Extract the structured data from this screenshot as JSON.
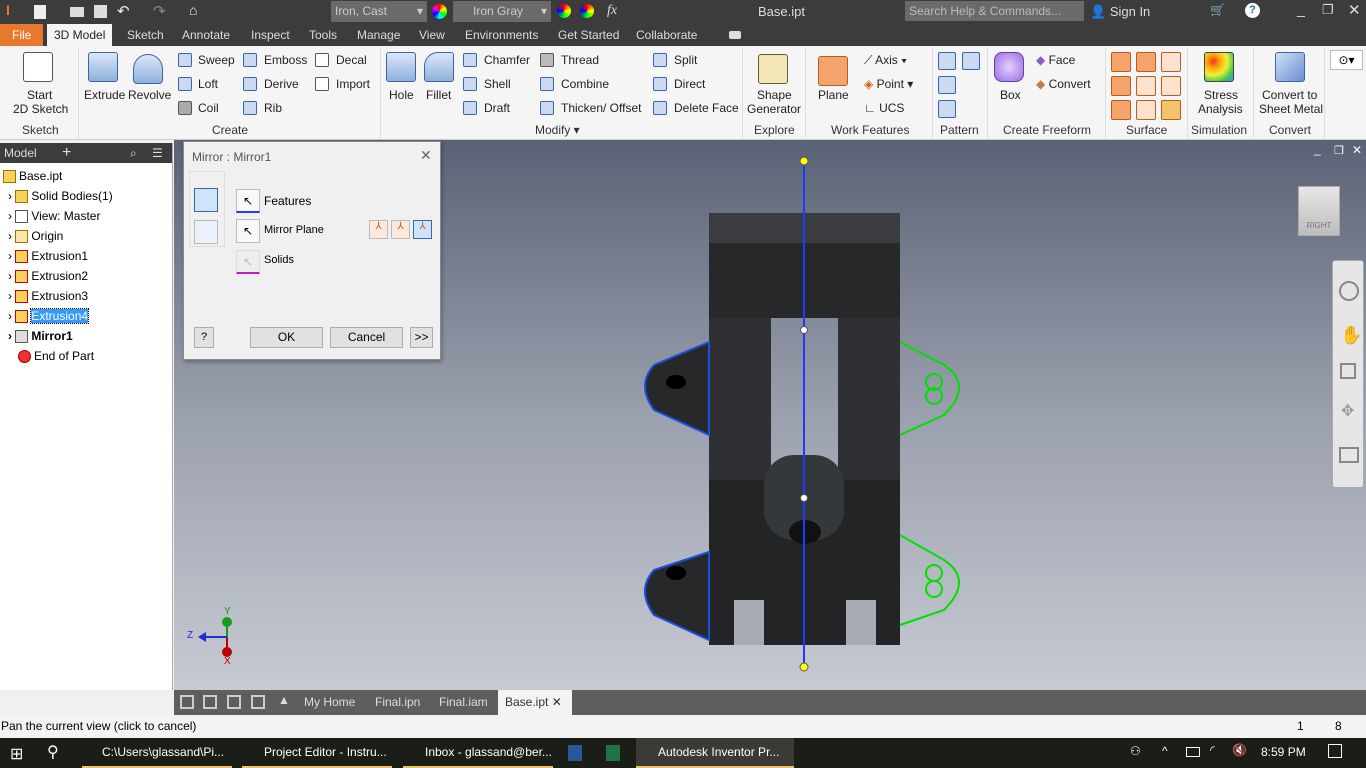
{
  "window": {
    "title": "Base.ipt",
    "search_placeholder": "Search Help & Commands...",
    "sign_in": "Sign In"
  },
  "qat": {
    "material": "Iron, Cast",
    "appearance": "Iron Gray",
    "fx": "fx"
  },
  "tabs": [
    "File",
    "3D Model",
    "Sketch",
    "Annotate",
    "Inspect",
    "Tools",
    "Manage",
    "View",
    "Environments",
    "Get Started",
    "Collaborate"
  ],
  "ribbon": {
    "sketch": {
      "start": "Start",
      "start2": "2D Sketch",
      "group": "Sketch"
    },
    "create": {
      "extrude": "Extrude",
      "revolve": "Revolve",
      "sweep": "Sweep",
      "loft": "Loft",
      "coil": "Coil",
      "emboss": "Emboss",
      "derive": "Derive",
      "rib": "Rib",
      "decal": "Decal",
      "import": "Import",
      "group": "Create"
    },
    "modify": {
      "hole": "Hole",
      "fillet": "Fillet",
      "chamfer": "Chamfer",
      "shell": "Shell",
      "draft": "Draft",
      "thread": "Thread",
      "combine": "Combine",
      "thicken": "Thicken/ Offset",
      "split": "Split",
      "direct": "Direct",
      "delete_face": "Delete Face",
      "group": "Modify"
    },
    "explore": {
      "shape1": "Shape",
      "shape2": "Generator",
      "group": "Explore"
    },
    "work": {
      "plane": "Plane",
      "axis": "Axis",
      "point": "Point",
      "ucs": "UCS",
      "group": "Work Features"
    },
    "pattern": {
      "group": "Pattern"
    },
    "freeform": {
      "box": "Box",
      "face": "Face",
      "convert": "Convert",
      "group": "Create Freeform"
    },
    "surface": {
      "group": "Surface"
    },
    "simulation": {
      "s1": "Stress",
      "s2": "Analysis",
      "group": "Simulation"
    },
    "convert": {
      "c1": "Convert to",
      "c2": "Sheet Metal",
      "group": "Convert"
    }
  },
  "browser": {
    "tab": "Model",
    "items": [
      {
        "label": "Base.ipt"
      },
      {
        "label": "Solid Bodies(1)"
      },
      {
        "label": "View: Master"
      },
      {
        "label": "Origin"
      },
      {
        "label": "Extrusion1"
      },
      {
        "label": "Extrusion2"
      },
      {
        "label": "Extrusion3"
      },
      {
        "label": "Extrusion4"
      },
      {
        "label": "Mirror1"
      },
      {
        "label": "End of Part"
      }
    ]
  },
  "dialog": {
    "title": "Mirror : Mirror1",
    "features": "Features",
    "mirror_plane": "Mirror Plane",
    "solids": "Solids",
    "ok": "OK",
    "cancel": "Cancel",
    "more": ">>",
    "help": "?"
  },
  "viewcube": {
    "face": "RIGHT"
  },
  "triad": {
    "y": "Y",
    "z": "Z",
    "x": "X"
  },
  "doc_tabs": [
    "My Home",
    "Final.ipn",
    "Final.iam",
    "Base.ipt"
  ],
  "status": {
    "message": "Pan the current view (click to cancel)",
    "count1": "1",
    "count2": "8"
  },
  "taskbar": {
    "items": [
      "C:\\Users\\glassand\\Pi...",
      "Project Editor - Instru...",
      "Inbox - glassand@ber...",
      "Autodesk Inventor Pr..."
    ],
    "time": "8:59 PM"
  },
  "colors": {
    "accent": "#e8782b",
    "mirror_plane": "#1a3cff",
    "preview": "#00e000",
    "selection": "#0a4fd6"
  }
}
